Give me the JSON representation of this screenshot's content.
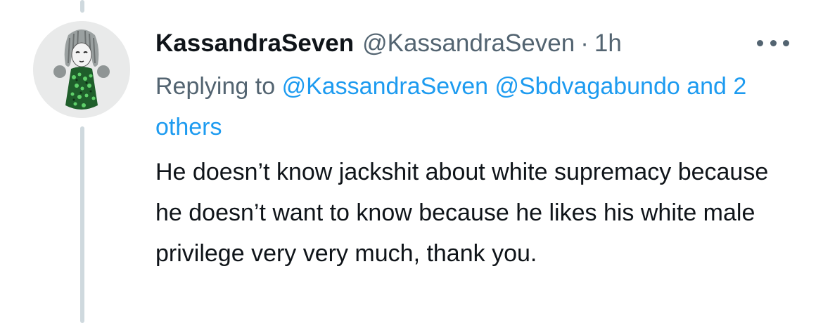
{
  "tweet": {
    "display_name": "KassandraSeven",
    "handle": "@KassandraSeven",
    "separator": "·",
    "time": "1h",
    "replying_prefix": "Replying to",
    "reply_mention_1": "@KassandraSeven",
    "reply_mention_2": "@Sbdvagabundo",
    "reply_others": "and 2 others",
    "text": "He doesn’t know jackshit about white supremacy because he doesn’t want to know because he likes his white male privilege very very much, thank you."
  },
  "icons": {
    "more": "more-horizontal-icon",
    "avatar": "avatar"
  },
  "colors": {
    "link": "#1d9bf0",
    "secondary_text": "#536471",
    "primary_text": "#0f1419",
    "thread_line": "#cfd9de"
  }
}
